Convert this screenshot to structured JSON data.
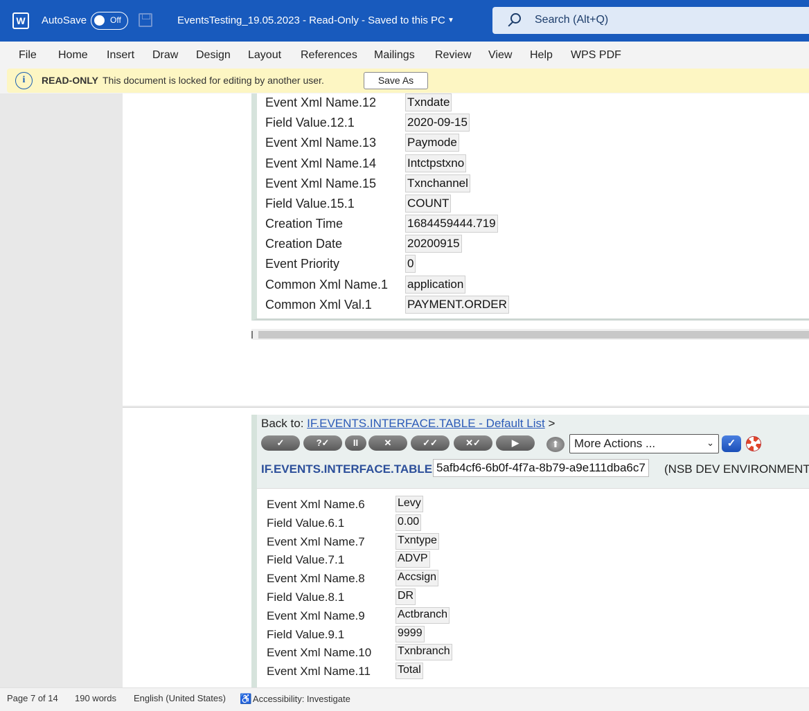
{
  "titlebar": {
    "app_icon": "word-icon",
    "autosave_label": "AutoSave",
    "autosave_state": "Off",
    "doc_title": "EventsTesting_19.05.2023  -  Read-Only  -  Saved to this PC",
    "search_placeholder": "Search (Alt+Q)"
  },
  "menu": {
    "items": [
      "File",
      "Home",
      "Insert",
      "Draw",
      "Design",
      "Layout",
      "References",
      "Mailings",
      "Review",
      "View",
      "Help",
      "WPS PDF"
    ]
  },
  "infobar": {
    "label": "READ-ONLY",
    "message": "This document is locked for editing by another user.",
    "button": "Save As"
  },
  "page1": {
    "rows": [
      {
        "label": "Event Xml Name.12",
        "value": "Txndate"
      },
      {
        "label": "Field Value.12.1",
        "value": "2020-09-15"
      },
      {
        "label": "Event Xml Name.13",
        "value": "Paymode"
      },
      {
        "label": "Event Xml Name.14",
        "value": "Intctpstxno"
      },
      {
        "label": "Event Xml Name.15",
        "value": "Txnchannel"
      },
      {
        "label": "Field Value.15.1",
        "value": "COUNT"
      },
      {
        "label": "Creation Time",
        "value": "1684459444.719"
      },
      {
        "label": "Creation Date",
        "value": "20200915"
      },
      {
        "label": "Event Priority",
        "value": "0"
      },
      {
        "label": "Common Xml Name.1",
        "value": "application"
      },
      {
        "label": "Common Xml Val.1",
        "value": "PAYMENT.ORDER"
      }
    ]
  },
  "page2": {
    "back_to_label": "Back to:",
    "back_to_link": "IF.EVENTS.INTERFACE.TABLE - Default List",
    "back_to_suffix": ">",
    "toolbar": [
      "✓",
      "?✓",
      "II",
      "✕",
      "✓✓",
      "✕✓",
      "▶"
    ],
    "more_actions": "More Actions ...",
    "record_name": "IF.EVENTS.INTERFACE.TABLE",
    "record_id": "5afb4cf6-6b0f-4f7a-8b79-a9e111dba6c7",
    "record_env": "(NSB DEV ENVIRONMENT)",
    "rows": [
      {
        "label": "Event Xml Name.6",
        "value": "Levy"
      },
      {
        "label": "Field Value.6.1",
        "value": "0.00"
      },
      {
        "label": "Event Xml Name.7",
        "value": "Txntype"
      },
      {
        "label": "Field Value.7.1",
        "value": "ADVP"
      },
      {
        "label": "Event Xml Name.8",
        "value": "Accsign"
      },
      {
        "label": "Field Value.8.1",
        "value": "DR"
      },
      {
        "label": "Event Xml Name.9",
        "value": "Actbranch"
      },
      {
        "label": "Field Value.9.1",
        "value": "9999"
      },
      {
        "label": "Event Xml Name.10",
        "value": "Txnbranch"
      },
      {
        "label": "Event Xml Name.11",
        "value": "Total"
      }
    ]
  },
  "statusbar": {
    "page": "Page 7 of 14",
    "words": "190 words",
    "language": "English (United States)",
    "accessibility": "Accessibility: Investigate"
  }
}
